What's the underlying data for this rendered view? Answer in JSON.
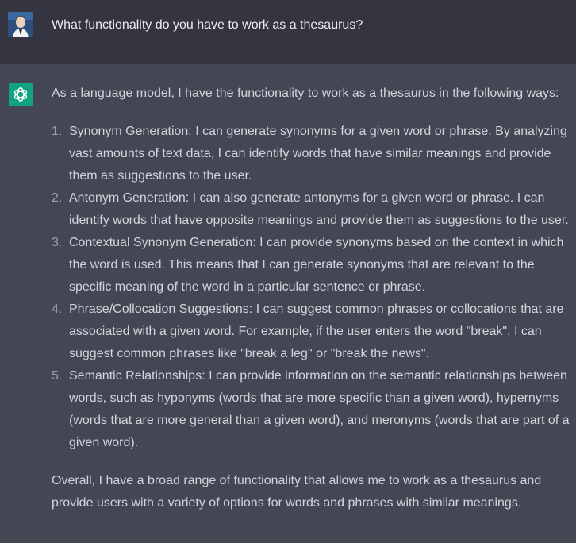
{
  "user": {
    "avatar_icon": "user-avatar-photo",
    "message": "What functionality do you have to work as a thesaurus?"
  },
  "assistant": {
    "avatar_icon": "openai-logo-icon",
    "intro": "As a language model, I have the functionality to work as a thesaurus in the following ways:",
    "items": [
      {
        "num": "1.",
        "text": "Synonym Generation: I can generate synonyms for a given word or phrase. By analyzing vast amounts of text data, I can identify words that have similar meanings and provide them as suggestions to the user."
      },
      {
        "num": "2.",
        "text": "Antonym Generation: I can also generate antonyms for a given word or phrase. I can identify words that have opposite meanings and provide them as suggestions to the user."
      },
      {
        "num": "3.",
        "text": "Contextual Synonym Generation: I can provide synonyms based on the context in which the word is used. This means that I can generate synonyms that are relevant to the specific meaning of the word in a particular sentence or phrase."
      },
      {
        "num": "4.",
        "text": "Phrase/Collocation Suggestions: I can suggest common phrases or collocations that are associated with a given word. For example, if the user enters the word \"break\", I can suggest common phrases like \"break a leg\" or \"break the news\"."
      },
      {
        "num": "5.",
        "text": "Semantic Relationships: I can provide information on the semantic relationships between words, such as hyponyms (words that are more specific than a given word), hypernyms (words that are more general than a given word), and meronyms (words that are part of a given word)."
      }
    ],
    "outro": "Overall, I have a broad range of functionality that allows me to work as a thesaurus and provide users with a variety of options for words and phrases with similar meanings."
  },
  "colors": {
    "user_bg": "#343541",
    "assistant_bg": "#444654",
    "accent": "#10a37f",
    "text": "#d1d5db"
  }
}
